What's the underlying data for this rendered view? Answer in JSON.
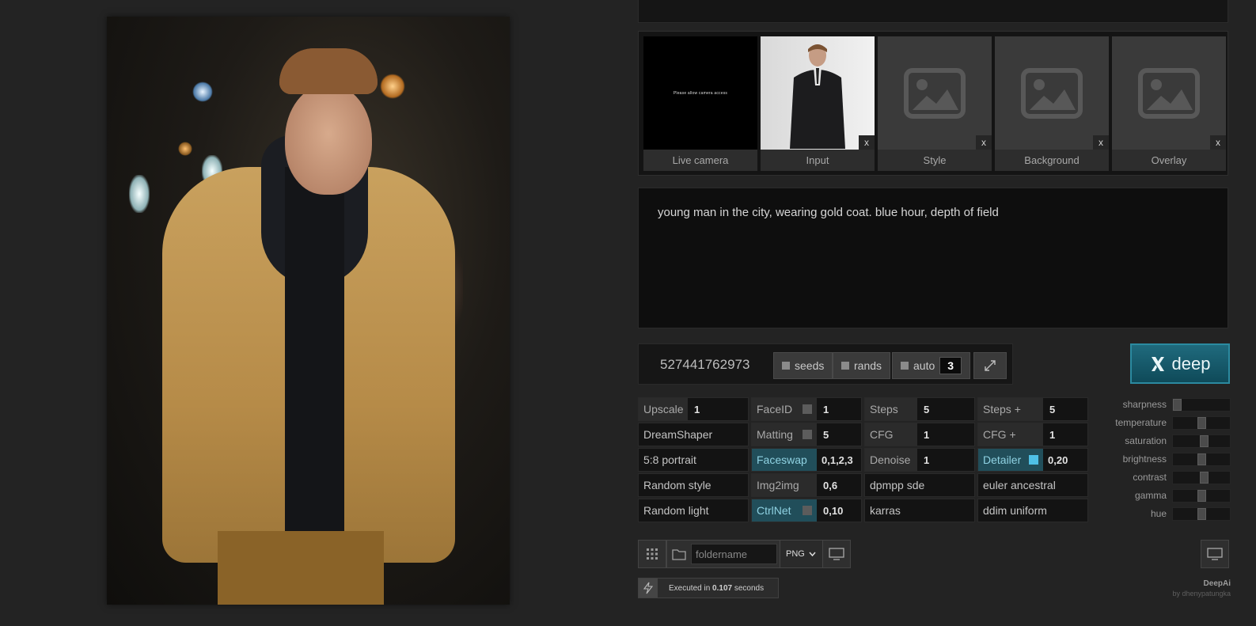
{
  "slots": [
    {
      "label": "Live camera",
      "close": ""
    },
    {
      "label": "Input",
      "close": "x"
    },
    {
      "label": "Style",
      "close": "x"
    },
    {
      "label": "Background",
      "close": "x"
    },
    {
      "label": "Overlay",
      "close": "x"
    }
  ],
  "camera_text": "Please allow camera access",
  "prompt": "young man in the city, wearing gold coat. blue hour, depth of field",
  "seed": {
    "value": "527441762973",
    "seeds_label": "seeds",
    "rands_label": "rands",
    "auto_label": "auto",
    "auto_count": "3"
  },
  "generate_label": "deep",
  "settings": {
    "col1": [
      "Upscale",
      "DreamShaper",
      "5:8 portrait",
      "Random style",
      "Random light"
    ],
    "upscale_value": "1",
    "col2": [
      {
        "label": "FaceID",
        "value": "1"
      },
      {
        "label": "Matting",
        "value": "5"
      },
      {
        "label": "Faceswap",
        "value": "0,1,2,3"
      },
      {
        "label": "Img2img",
        "value": "0,6"
      },
      {
        "label": "CtrlNet",
        "value": "0,10"
      }
    ],
    "col3": [
      {
        "label": "Steps",
        "value": "5"
      },
      {
        "label": "CFG",
        "value": "1"
      },
      {
        "label": "Denoise",
        "value": "1"
      },
      {
        "label": "dpmpp sde",
        "value": ""
      },
      {
        "label": "karras",
        "value": ""
      }
    ],
    "col4": [
      {
        "label": "Steps +",
        "value": "5"
      },
      {
        "label": "CFG +",
        "value": "1"
      },
      {
        "label": "Detailer",
        "value": "0,20"
      },
      {
        "label": "euler ancestral",
        "value": ""
      },
      {
        "label": "ddim uniform",
        "value": ""
      }
    ]
  },
  "adjustments": [
    {
      "label": "sharpness",
      "level": 0.0
    },
    {
      "label": "temperature",
      "level": 0.5
    },
    {
      "label": "saturation",
      "level": 0.55
    },
    {
      "label": "brightness",
      "level": 0.5
    },
    {
      "label": "contrast",
      "level": 0.55
    },
    {
      "label": "gamma",
      "level": 0.5
    },
    {
      "label": "hue",
      "level": 0.5
    }
  ],
  "toolbar": {
    "folder_placeholder": "foldername",
    "format": "PNG"
  },
  "execution": {
    "prefix": "Executed in ",
    "time": "0.107",
    "suffix": " seconds"
  },
  "brand": {
    "name": "DeepAi",
    "byline": "by dhenypatungka"
  },
  "colors": {
    "accent": "#1f6a7d",
    "checkbox_on": "#4fc0e6"
  }
}
